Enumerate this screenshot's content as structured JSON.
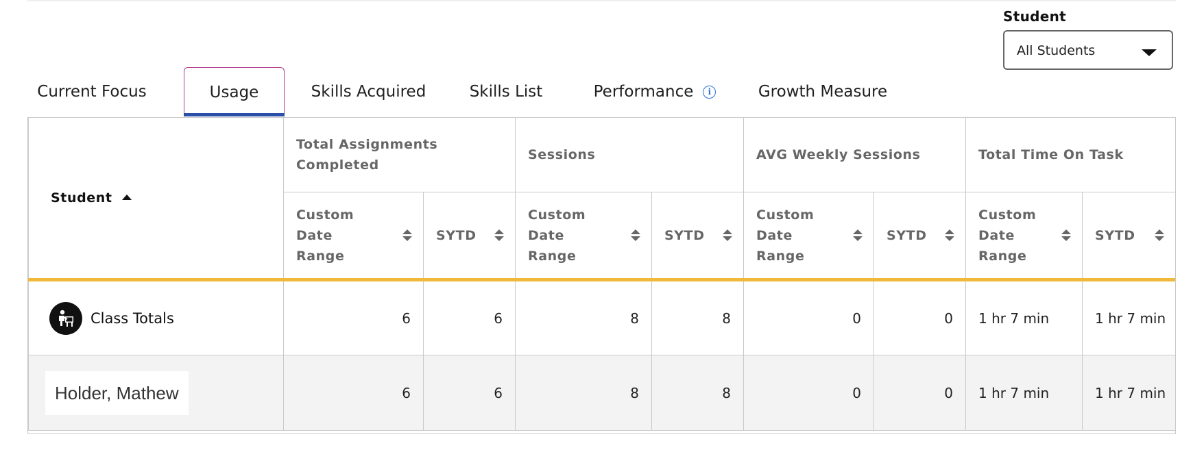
{
  "filter": {
    "label": "Student",
    "selected": "All Students"
  },
  "tabs": [
    {
      "label": "Current Focus"
    },
    {
      "label": "Usage"
    },
    {
      "label": "Skills Acquired"
    },
    {
      "label": "Skills List"
    },
    {
      "label": "Performance"
    },
    {
      "label": "Growth Measure"
    }
  ],
  "active_tab": "Usage",
  "table": {
    "student_header": "Student",
    "groups": [
      "Total Assignments Completed",
      "Sessions",
      "AVG Weekly Sessions",
      "Total Time On Task"
    ],
    "sub_custom": "Custom Date Range",
    "sub_sytd": "SYTD",
    "totals_row": {
      "label": "Class Totals",
      "values": [
        "6",
        "6",
        "8",
        "8",
        "0",
        "0",
        "1 hr 7 min",
        "1 hr 7 min"
      ]
    },
    "rows": [
      {
        "name": "Holder, Mathew",
        "values": [
          "6",
          "6",
          "8",
          "8",
          "0",
          "0",
          "1 hr 7 min",
          "1 hr 7 min"
        ]
      }
    ]
  },
  "colors": {
    "accent_tab_border": "#b03b8a",
    "tab_underline": "#2a4fa8",
    "header_rule": "#f0b93b",
    "info": "#2a6fd6"
  },
  "icons": [
    "chevron-down-icon",
    "info-icon",
    "sort-ascending-icon",
    "sort-icon",
    "class-totals-icon"
  ]
}
